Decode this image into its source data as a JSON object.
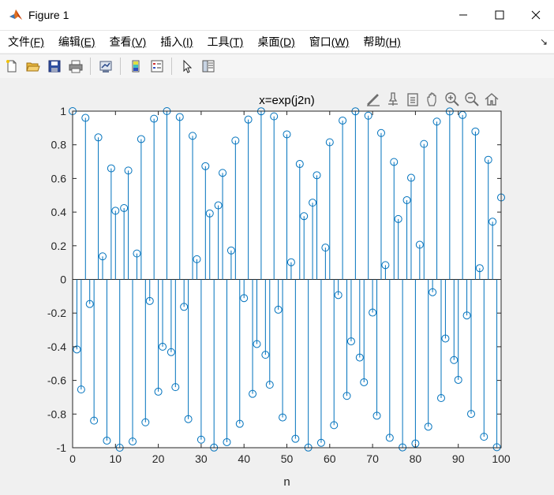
{
  "window": {
    "title": "Figure 1",
    "icon": "matlab-icon",
    "controls": [
      "minimize-icon",
      "maximize-icon",
      "close-icon"
    ]
  },
  "menubar": {
    "items": [
      {
        "label": "文件",
        "mnemonic": "(F)"
      },
      {
        "label": "编辑",
        "mnemonic": "(E)"
      },
      {
        "label": "查看",
        "mnemonic": "(V)"
      },
      {
        "label": "插入",
        "mnemonic": "(I)"
      },
      {
        "label": "工具",
        "mnemonic": "(T)"
      },
      {
        "label": "桌面",
        "mnemonic": "(D)"
      },
      {
        "label": "窗口",
        "mnemonic": "(W)"
      },
      {
        "label": "帮助",
        "mnemonic": "(H)"
      }
    ]
  },
  "toolbar": {
    "icons": [
      "new-figure-icon",
      "open-file-icon",
      "save-icon",
      "print-icon",
      "link-plot-icon",
      "insert-colorbar-icon",
      "insert-legend-icon",
      "edit-plot-pointer-icon",
      "property-inspector-icon"
    ]
  },
  "axes_toolbar": {
    "icons": [
      "brush-data-icon",
      "data-tips-icon",
      "export-icon",
      "pan-icon",
      "zoom-in-icon",
      "zoom-out-icon",
      "restore-view-icon"
    ]
  },
  "colors": {
    "stem": "#0072bd",
    "axes_bg": "#ffffff",
    "figure_bg": "#f0f0f0"
  },
  "chart_data": {
    "type": "stem",
    "title": "x=exp(j2n)",
    "xlabel": "n",
    "ylabel": "",
    "xlim": [
      0,
      100
    ],
    "ylim": [
      -1,
      1
    ],
    "xticks": [
      "0",
      "10",
      "20",
      "30",
      "40",
      "50",
      "60",
      "70",
      "80",
      "90",
      "100"
    ],
    "yticks": [
      "1",
      "0.8",
      "0.6",
      "0.4",
      "0.2",
      "0",
      "-0.2",
      "-0.4",
      "-0.6",
      "-0.8",
      "-1"
    ],
    "grid": false,
    "marker": "open-circle",
    "n": [
      0,
      1,
      2,
      3,
      4,
      5,
      6,
      7,
      8,
      9,
      10,
      11,
      12,
      13,
      14,
      15,
      16,
      17,
      18,
      19,
      20,
      21,
      22,
      23,
      24,
      25,
      26,
      27,
      28,
      29,
      30,
      31,
      32,
      33,
      34,
      35,
      36,
      37,
      38,
      39,
      40,
      41,
      42,
      43,
      44,
      45,
      46,
      47,
      48,
      49,
      50,
      51,
      52,
      53,
      54,
      55,
      56,
      57,
      58,
      59,
      60,
      61,
      62,
      63,
      64,
      65,
      66,
      67,
      68,
      69,
      70,
      71,
      72,
      73,
      74,
      75,
      76,
      77,
      78,
      79,
      80,
      81,
      82,
      83,
      84,
      85,
      86,
      87,
      88,
      89,
      90,
      91,
      92,
      93,
      94,
      95,
      96,
      97,
      98,
      99,
      100
    ],
    "values": [
      1.0,
      -0.416,
      -0.654,
      0.96,
      -0.146,
      -0.839,
      0.844,
      0.137,
      -0.958,
      0.66,
      0.408,
      -1.0,
      0.424,
      0.647,
      -0.963,
      0.154,
      0.834,
      -0.849,
      -0.128,
      0.955,
      -0.667,
      -0.4,
      1.0,
      -0.432,
      -0.64,
      0.965,
      -0.163,
      -0.83,
      0.853,
      0.12,
      -0.952,
      0.673,
      0.392,
      -0.999,
      0.44,
      0.633,
      -0.967,
      0.172,
      0.825,
      -0.858,
      -0.111,
      0.95,
      -0.68,
      -0.384,
      0.999,
      -0.448,
      -0.626,
      0.969,
      -0.18,
      -0.82,
      0.862,
      0.102,
      -0.947,
      0.686,
      0.376,
      -0.999,
      0.456,
      0.619,
      -0.971,
      0.189,
      0.815,
      -0.866,
      -0.093,
      0.944,
      -0.692,
      -0.368,
      0.999,
      -0.464,
      -0.611,
      0.973,
      -0.197,
      -0.81,
      0.87,
      0.085,
      -0.941,
      0.698,
      0.359,
      -0.998,
      0.471,
      0.604,
      -0.975,
      0.206,
      0.805,
      -0.875,
      -0.076,
      0.938,
      -0.705,
      -0.351,
      0.998,
      -0.479,
      -0.597,
      0.977,
      -0.214,
      -0.799,
      0.879,
      0.067,
      -0.935,
      0.711,
      0.343,
      -0.997,
      0.487
    ]
  }
}
